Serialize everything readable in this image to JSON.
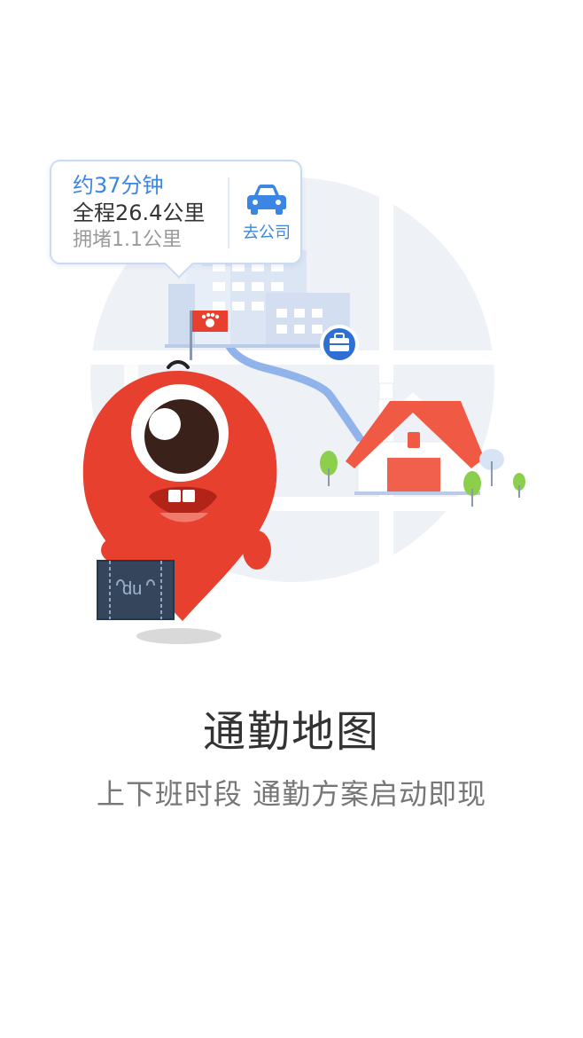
{
  "route_card": {
    "duration": "约37分钟",
    "distance": "全程26.4公里",
    "congestion": "拥堵1.1公里",
    "destination_label": "去公司",
    "destination_icon": "car-icon"
  },
  "illustration": {
    "bag_label": "du",
    "icons": [
      "office-building",
      "baidu-paw-flag",
      "briefcase-icon",
      "house",
      "tree",
      "mascot"
    ]
  },
  "title": "通勤地图",
  "subtitle": "上下班时段 通勤方案启动即现",
  "colors": {
    "accent_blue": "#3b86e4",
    "mascot_red": "#e8402f",
    "roof_red": "#f05a45",
    "tree_green": "#8ccf4d"
  }
}
